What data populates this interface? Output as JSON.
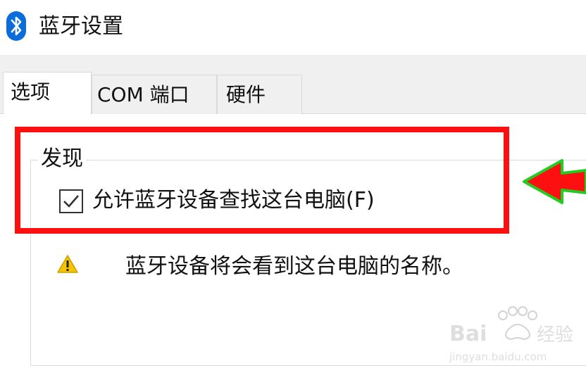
{
  "window": {
    "title": "蓝牙设置",
    "title_icon": "bluetooth-icon"
  },
  "tabs": [
    {
      "label": "选项",
      "active": true
    },
    {
      "label": "COM 端口",
      "active": false
    },
    {
      "label": "硬件",
      "active": false
    }
  ],
  "discovery": {
    "group_label": "发现",
    "checkbox_label": "允许蓝牙设备查找这台电脑(F)",
    "checkbox_checked": true,
    "warning_icon": "warning-icon",
    "warning_text": "蓝牙设备将会看到这台电脑的名称。"
  },
  "annotation": {
    "highlight_color": "#ff1010",
    "arrow_color": "#ff1010",
    "arrow_outline_color": "#22cc22"
  },
  "watermark": {
    "brand": "Baidu 经验",
    "url": "jingyan.baidu.com"
  },
  "colors": {
    "bluetooth": "#0a6ddb",
    "warning": "#f5c400"
  }
}
